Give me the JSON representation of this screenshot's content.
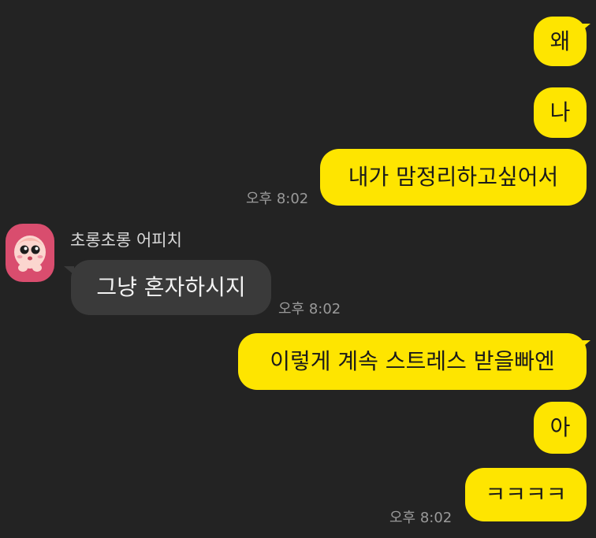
{
  "messages": {
    "m1": "왜",
    "m2": "나",
    "m3": "내가 맘정리하고싶어서",
    "m4": "그냥 혼자하시지",
    "m5": "이렇게 계속 스트레스 받을빠엔",
    "m6": "아",
    "m7": "ㅋㅋㅋㅋ"
  },
  "times": {
    "t1": "오후 8:02",
    "t2": "오후 8:02",
    "t3": "오후 8:02"
  },
  "sender": {
    "name": "초롱초롱 어피치",
    "avatar_icon": "apeach-character-icon"
  },
  "colors": {
    "background": "#232323",
    "my_bubble": "#fee500",
    "their_bubble": "#3a3a3a",
    "avatar_bg": "#d94d6e"
  }
}
